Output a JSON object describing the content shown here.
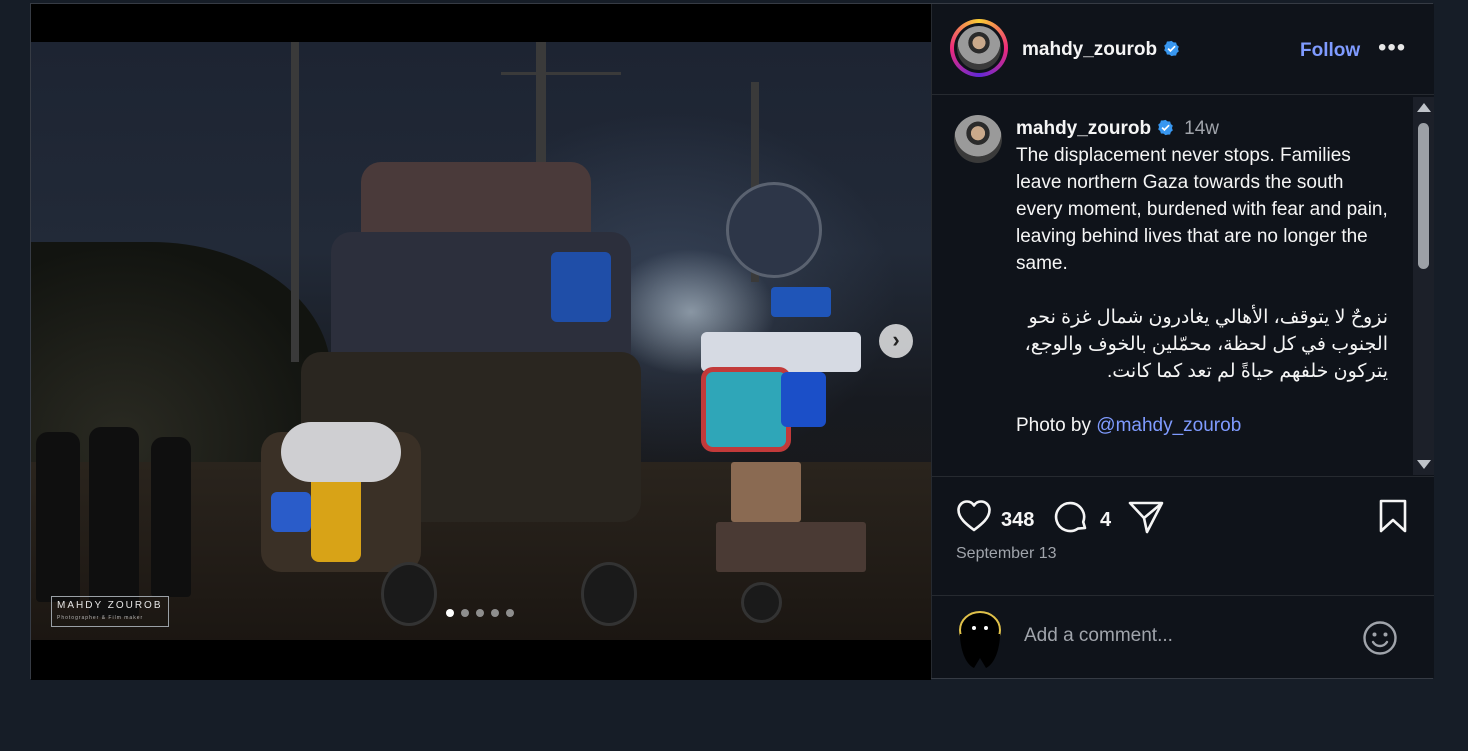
{
  "post": {
    "author": {
      "username": "mahdy_zourob",
      "verified": true
    },
    "follow_label": "Follow",
    "more_label": "•••",
    "photo": {
      "watermark_title": "MAHDY ZOUROB",
      "watermark_subtitle": "Photographer & Film maker",
      "carousel_count": 5,
      "carousel_active": 1,
      "next_label": "›"
    },
    "caption": {
      "username": "mahdy_zourob",
      "time": "14w",
      "english": "The displacement never stops. Families leave northern Gaza towards the south every moment, burdened with fear and pain, leaving behind lives that are no longer the same.",
      "arabic": "نزوحٌ لا يتوقف، الأهالي يغادرون شمال غزة نحو الجنوب في كل لحظة، محمّلين بالخوف والوجع، يتركون خلفهم حياةً لم تعد كما كانت.",
      "credit_prefix": "Photo by ",
      "credit_mention": "@mahdy_zourob"
    },
    "likes": "348",
    "comments": "4",
    "date": "September 13",
    "comment_placeholder": "Add a comment..."
  },
  "colors": {
    "accent": "#7f9bff",
    "verified": "#3897f0",
    "background": "#161d27"
  }
}
